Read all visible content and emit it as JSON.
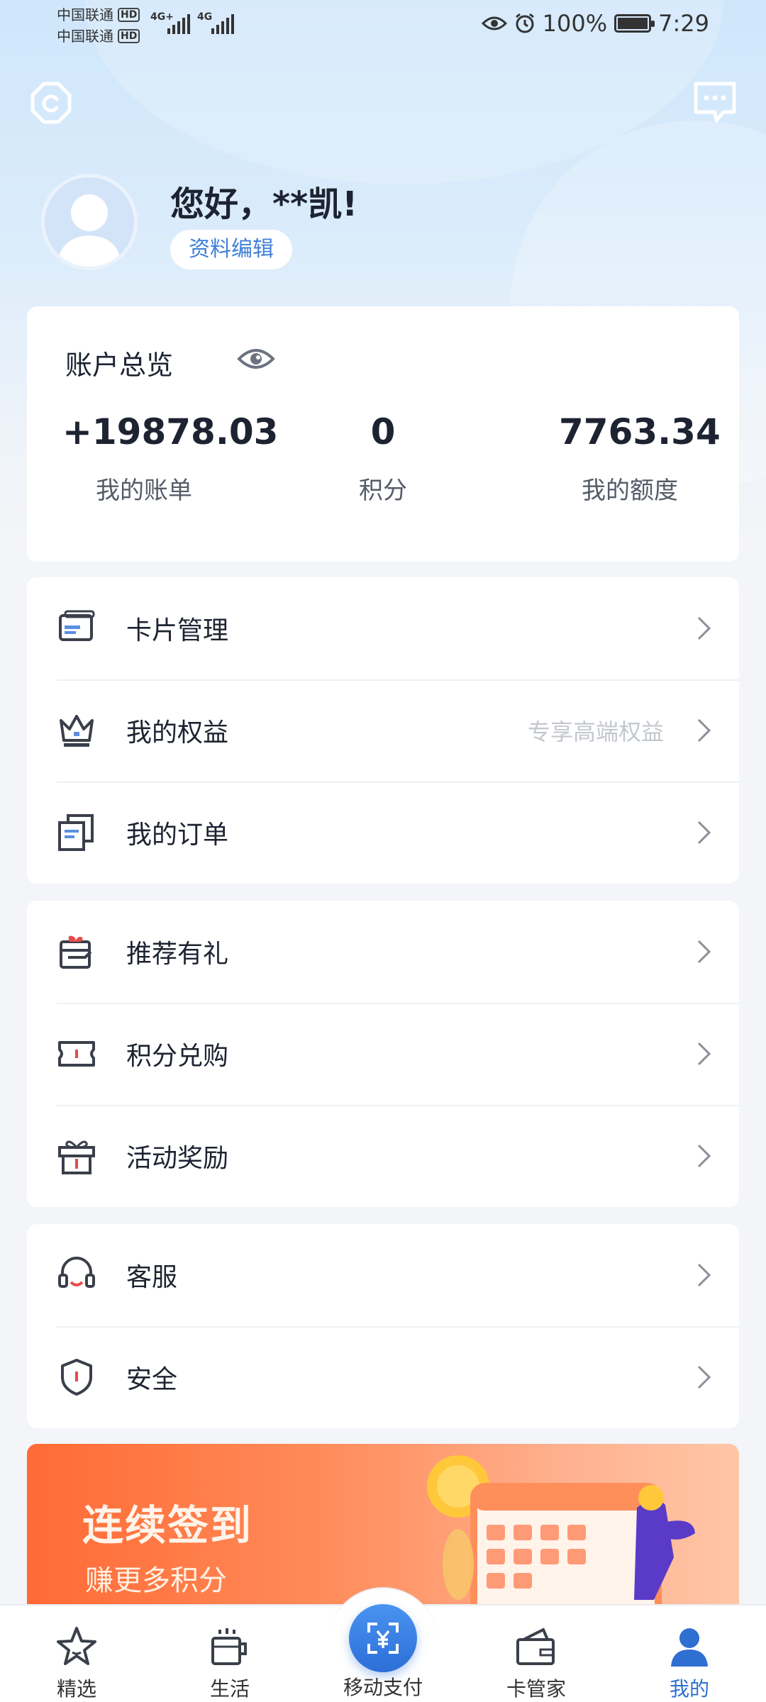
{
  "status_bar": {
    "carrier_1": "中国联通",
    "carrier_2": "中国联通",
    "hd": "HD",
    "network_1": "4G+",
    "network_2": "4G",
    "battery": "100%",
    "time": "7:29"
  },
  "profile": {
    "greeting": "您好，**凯!",
    "edit_label": "资料编辑"
  },
  "overview": {
    "title": "账户总览",
    "items": [
      {
        "value": "+19878.03",
        "label": "我的账单"
      },
      {
        "value": "0",
        "label": "积分"
      },
      {
        "value": "7763.34",
        "label": "我的额度"
      }
    ]
  },
  "menu_group_1": [
    {
      "label": "卡片管理",
      "extra": "",
      "icon": "card-icon"
    },
    {
      "label": "我的权益",
      "extra": "专享高端权益",
      "icon": "crown-icon"
    },
    {
      "label": "我的订单",
      "extra": "",
      "icon": "orders-icon"
    }
  ],
  "menu_group_2": [
    {
      "label": "推荐有礼",
      "extra": "",
      "icon": "referral-icon"
    },
    {
      "label": "积分兑购",
      "extra": "",
      "icon": "ticket-icon"
    },
    {
      "label": "活动奖励",
      "extra": "",
      "icon": "gift-icon"
    }
  ],
  "menu_group_3": [
    {
      "label": "客服",
      "extra": "",
      "icon": "headset-icon"
    },
    {
      "label": "安全",
      "extra": "",
      "icon": "shield-icon"
    }
  ],
  "banner": {
    "title": "连续签到",
    "subtitle": "赚更多积分"
  },
  "tabs": [
    {
      "label": "精选",
      "icon": "star-icon",
      "active": false
    },
    {
      "label": "生活",
      "icon": "cup-icon",
      "active": false
    },
    {
      "label": "移动支付",
      "icon": "scan-pay-icon",
      "active": false
    },
    {
      "label": "卡管家",
      "icon": "wallet-icon",
      "active": false
    },
    {
      "label": "我的",
      "icon": "user-icon",
      "active": true
    }
  ],
  "colors": {
    "accent": "#2f6fd1",
    "icon_red": "#e94a4a",
    "banner_orange": "#ff6a35"
  }
}
